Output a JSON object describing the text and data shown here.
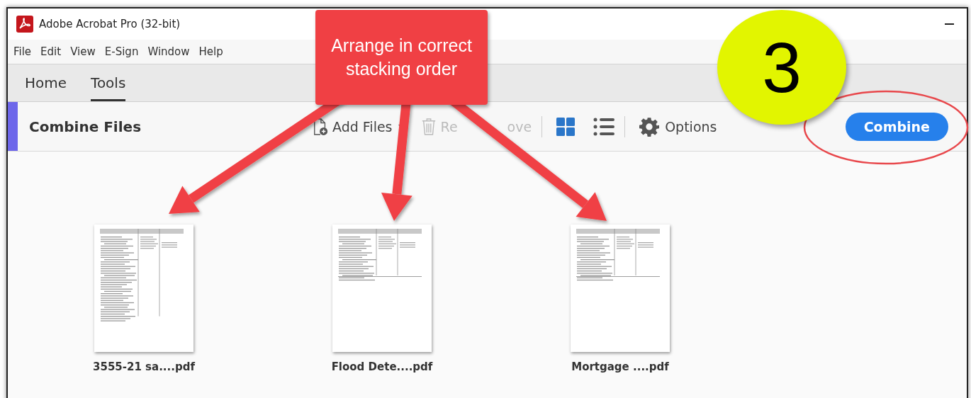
{
  "window": {
    "title": "Adobe Acrobat Pro (32-bit)"
  },
  "menu": [
    "File",
    "Edit",
    "View",
    "E-Sign",
    "Window",
    "Help"
  ],
  "tabs": [
    {
      "label": "Home",
      "selected": false
    },
    {
      "label": "Tools",
      "selected": true
    }
  ],
  "toolbar": {
    "title": "Combine Files",
    "actions": [
      {
        "kind": "add",
        "label": "Add Files",
        "disabled": false
      },
      {
        "kind": "remove",
        "label": "Re",
        "label_rest": "ove",
        "disabled": true
      }
    ],
    "views": [
      {
        "kind": "grid",
        "selected": true
      },
      {
        "kind": "list",
        "selected": false
      }
    ],
    "options": "Options",
    "primary": "Combine"
  },
  "files": [
    {
      "name": "3555-21 sa....pdf",
      "kind": "long"
    },
    {
      "name": "Flood Dete....pdf",
      "kind": "short"
    },
    {
      "name": "Mortgage ....pdf",
      "kind": "short"
    }
  ],
  "annotations": {
    "callout": "Arrange in correct stacking order",
    "step": "3"
  }
}
